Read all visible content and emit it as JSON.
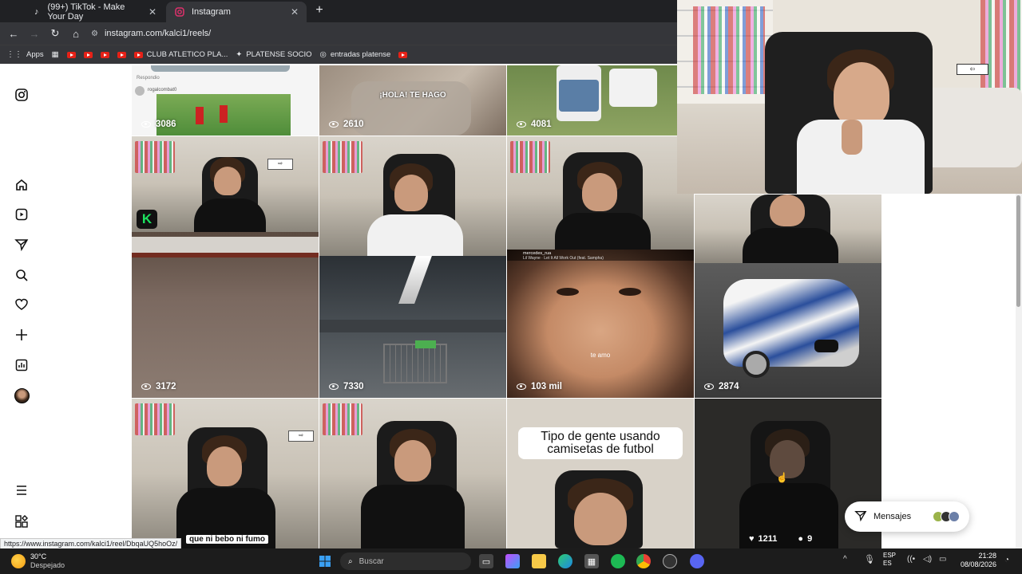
{
  "tabs": [
    {
      "title": "(99+) TikTok - Make Your Day",
      "active": false
    },
    {
      "title": "Instagram",
      "active": true
    }
  ],
  "address": {
    "url": "instagram.com/kalci1/reels/"
  },
  "bookmarks": {
    "apps": "Apps",
    "club": "CLUB ATLETICO PLA...",
    "socio": "PLATENSE SOCIO",
    "entradas": "entradas platense"
  },
  "grid": {
    "row0": [
      "3086",
      "2610",
      "4081"
    ],
    "row1": [
      "3172",
      "7330",
      "103 mil",
      "2874"
    ],
    "tile_captions": {
      "hola": "¡HOLA! TE HAGO",
      "teamo": "te amo",
      "futbol": "Tipo de gente usando camisetas de futbol",
      "bebo": "que ni bebo ni fumo",
      "reel_account": "mercedes_rua",
      "reel_music": "Lil Wayne · Let It All Work Out (feat. Sampha)",
      "post_user": "rogalcombat0",
      "post_sub": "Respondio"
    },
    "last_tile": {
      "likes": "1211",
      "comments": "9"
    }
  },
  "messages": {
    "label": "Mensajes"
  },
  "status_url": "https://www.instagram.com/kalci1/reel/DbqaUQ5hoOz/",
  "taskbar": {
    "temp": "30°C",
    "weather": "Despejado",
    "search": "Buscar",
    "lang1": "ESP",
    "lang2": "ES",
    "time": "21:28",
    "date": "08/08/2026"
  },
  "colors": {
    "chrome_dark": "#202124",
    "chrome_bar": "#35363a",
    "taskbar": "#1c1c1c",
    "instagram_pink": "#e1306c"
  }
}
